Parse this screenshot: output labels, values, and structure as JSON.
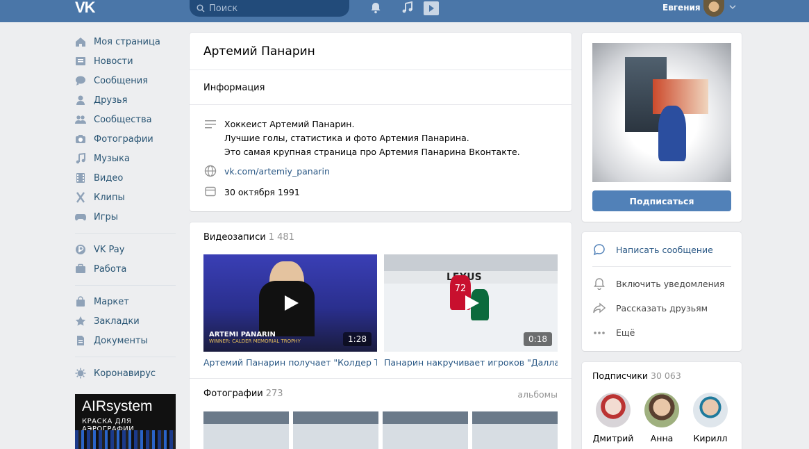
{
  "header": {
    "logo": "VK",
    "search_placeholder": "Поиск",
    "user_name": "Евгения"
  },
  "nav": {
    "group1": [
      {
        "label": "Моя страница",
        "icon": "home-icon"
      },
      {
        "label": "Новости",
        "icon": "news-icon"
      },
      {
        "label": "Сообщения",
        "icon": "messages-icon"
      },
      {
        "label": "Друзья",
        "icon": "friends-icon"
      },
      {
        "label": "Сообщества",
        "icon": "communities-icon"
      },
      {
        "label": "Фотографии",
        "icon": "camera-icon"
      },
      {
        "label": "Музыка",
        "icon": "music-icon"
      },
      {
        "label": "Видео",
        "icon": "video-icon"
      },
      {
        "label": "Клипы",
        "icon": "clips-icon"
      },
      {
        "label": "Игры",
        "icon": "games-icon"
      }
    ],
    "group2": [
      {
        "label": "VK Pay",
        "icon": "vkpay-icon"
      },
      {
        "label": "Работа",
        "icon": "briefcase-icon"
      }
    ],
    "group3": [
      {
        "label": "Маркет",
        "icon": "market-icon"
      },
      {
        "label": "Закладки",
        "icon": "star-icon"
      },
      {
        "label": "Документы",
        "icon": "document-icon"
      }
    ],
    "group4": [
      {
        "label": "Коронавирус",
        "icon": "virus-icon"
      }
    ]
  },
  "ad": {
    "title": "AIRsystem",
    "subtitle": "КРАСКА ДЛЯ АЭРОГРАФИИ"
  },
  "profile": {
    "title": "Артемий Панарин",
    "info_heading": "Информация",
    "description": [
      "Хоккеист Артемий Панарин.",
      "Лучшие голы, статистика и фото Артемия Панарина.",
      "Это самая крупная страница про Артемия Панарина Вконтакте."
    ],
    "link": "vk.com/artemiy_panarin",
    "date": "30 октября 1991"
  },
  "videos": {
    "heading": "Видеозаписи",
    "count": "1 481",
    "items": [
      {
        "caption": "Артемий Панарин получает \"Колдер Трофи\"",
        "duration": "1:28",
        "overlay_name": "ARTEMI PANARIN",
        "overlay_sub": "WINNER: CALDER MEMORIAL TROPHY"
      },
      {
        "caption": "Панарин накручивает игроков \"Далласа\"",
        "duration": "0:18",
        "jersey": "72"
      }
    ]
  },
  "photos": {
    "heading": "Фотографии",
    "count": "273",
    "albums_link": "альбомы"
  },
  "actions": {
    "subscribe": "Подписаться",
    "write": "Написать сообщение",
    "notify": "Включить уведомления",
    "share": "Рассказать друзьям",
    "more": "Ещё"
  },
  "subscribers": {
    "heading": "Подписчики",
    "count": "30 063",
    "items": [
      {
        "name": "Дмитрий"
      },
      {
        "name": "Анна"
      },
      {
        "name": "Кирилл"
      }
    ]
  },
  "colors": {
    "header": "#4a76a8",
    "link": "#2a5885",
    "button": "#5181b8",
    "background": "#edeef0"
  }
}
